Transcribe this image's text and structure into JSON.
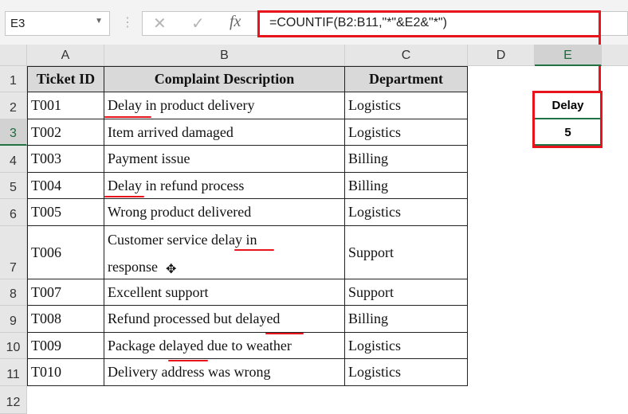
{
  "name_box": "E3",
  "formula_bar": {
    "cancel_icon": "✕",
    "enter_icon": "✓",
    "fx_label": "fx",
    "formula": "=COUNTIF(B2:B11,\"*\"&E2&\"*\")"
  },
  "columns": [
    "A",
    "B",
    "C",
    "D",
    "E"
  ],
  "rows": [
    "1",
    "2",
    "3",
    "4",
    "5",
    "6",
    "7",
    "8",
    "9",
    "10",
    "11",
    "12"
  ],
  "headers": {
    "id": "Ticket ID",
    "desc": "Complaint Description",
    "dept": "Department"
  },
  "records": [
    {
      "id": "T001",
      "desc": "Delay in product delivery",
      "dept": "Logistics"
    },
    {
      "id": "T002",
      "desc": "Item arrived damaged",
      "dept": "Logistics"
    },
    {
      "id": "T003",
      "desc": "Payment issue",
      "dept": "Billing"
    },
    {
      "id": "T004",
      "desc": "Delay in refund process",
      "dept": "Billing"
    },
    {
      "id": "T005",
      "desc": "Wrong product delivered",
      "dept": "Logistics"
    },
    {
      "id": "T006",
      "desc": "Customer service delay in response",
      "dept": "Support"
    },
    {
      "id": "T007",
      "desc": "Excellent support",
      "dept": "Support"
    },
    {
      "id": "T008",
      "desc": "Refund processed but delayed",
      "dept": "Billing"
    },
    {
      "id": "T009",
      "desc": "Package delayed due to weather",
      "dept": "Logistics"
    },
    {
      "id": "T010",
      "desc": "Delivery address was wrong",
      "dept": "Logistics"
    }
  ],
  "lookup": {
    "keyword": "Delay",
    "count": "5"
  },
  "accent": "#e8141b"
}
